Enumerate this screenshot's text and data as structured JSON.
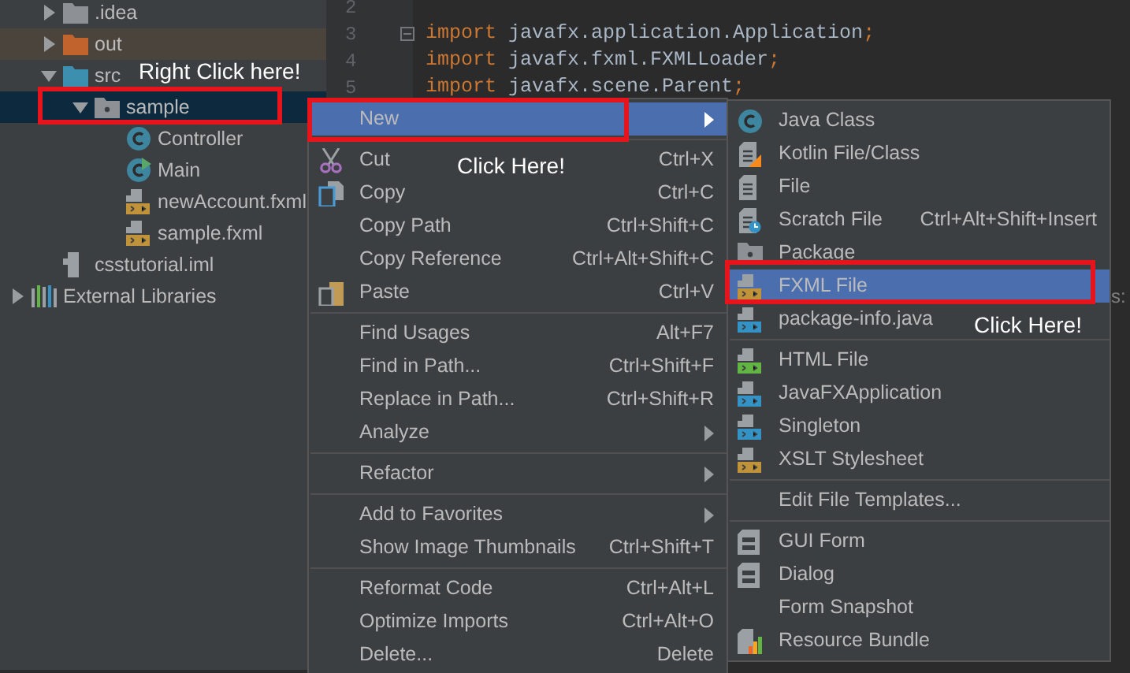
{
  "tree": [
    {
      "kind": "folder",
      "label": ".idea",
      "color": "#8d9195",
      "expanded": false,
      "selected": false
    },
    {
      "kind": "folder",
      "label": "out",
      "color": "#c0632c",
      "expanded": false,
      "selected": false,
      "excluded": true
    },
    {
      "kind": "folder",
      "label": "src",
      "color": "#3d8fb0",
      "expanded": true,
      "selected": false,
      "children": [
        {
          "kind": "package",
          "label": "sample",
          "expanded": true,
          "selected": true,
          "children": [
            {
              "kind": "class",
              "label": "Controller",
              "selected": false
            },
            {
              "kind": "main-class",
              "label": "Main",
              "selected": false
            },
            {
              "kind": "fxml",
              "label": "newAccount.fxml",
              "selected": false
            },
            {
              "kind": "fxml",
              "label": "sample.fxml",
              "selected": false
            }
          ]
        }
      ]
    },
    {
      "kind": "iml",
      "label": "csstutorial.iml",
      "selected": false
    },
    {
      "kind": "library",
      "label": "External Libraries",
      "expanded": false,
      "selected": false
    }
  ],
  "editor": {
    "lines": [
      {
        "number": "2"
      },
      {
        "number": "3",
        "fold": true,
        "tokens": [
          {
            "kind": "keyword",
            "text": "import"
          },
          {
            "kind": "plain",
            "text": " javafx.application.Application"
          },
          {
            "kind": "keyword",
            "text": ";"
          }
        ]
      },
      {
        "number": "4",
        "tokens": [
          {
            "kind": "keyword",
            "text": "import"
          },
          {
            "kind": "plain",
            "text": " javafx.fxml.FXMLLoader"
          },
          {
            "kind": "keyword",
            "text": ";"
          }
        ]
      },
      {
        "number": "5",
        "tokens": [
          {
            "kind": "keyword",
            "text": "import"
          },
          {
            "kind": "plain",
            "text": " javafx.scene.Parent"
          },
          {
            "kind": "keyword",
            "text": ";"
          }
        ]
      }
    ],
    "fragment": "s:"
  },
  "context_menu": {
    "items": [
      {
        "kind": "item",
        "label": "New",
        "submenu": true,
        "selected": true
      },
      {
        "kind": "separator"
      },
      {
        "kind": "item",
        "label": "Cut",
        "shortcut": "Ctrl+X",
        "selected": false
      },
      {
        "kind": "item",
        "label": "Copy",
        "shortcut": "Ctrl+C",
        "selected": false
      },
      {
        "kind": "item",
        "label": "Copy Path",
        "shortcut": "Ctrl+Shift+C",
        "selected": false
      },
      {
        "kind": "item",
        "label": "Copy Reference",
        "shortcut": "Ctrl+Alt+Shift+C",
        "selected": false
      },
      {
        "kind": "item",
        "label": "Paste",
        "shortcut": "Ctrl+V",
        "selected": false
      },
      {
        "kind": "separator"
      },
      {
        "kind": "item",
        "label": "Find Usages",
        "shortcut": "Alt+F7",
        "selected": false
      },
      {
        "kind": "item",
        "label": "Find in Path...",
        "shortcut": "Ctrl+Shift+F",
        "selected": false
      },
      {
        "kind": "item",
        "label": "Replace in Path...",
        "shortcut": "Ctrl+Shift+R",
        "selected": false
      },
      {
        "kind": "item",
        "label": "Analyze",
        "submenu": true,
        "selected": false
      },
      {
        "kind": "separator"
      },
      {
        "kind": "item",
        "label": "Refactor",
        "submenu": true,
        "selected": false
      },
      {
        "kind": "separator"
      },
      {
        "kind": "item",
        "label": "Add to Favorites",
        "submenu": true,
        "selected": false
      },
      {
        "kind": "item",
        "label": "Show Image Thumbnails",
        "shortcut": "Ctrl+Shift+T",
        "selected": false
      },
      {
        "kind": "separator"
      },
      {
        "kind": "item",
        "label": "Reformat Code",
        "shortcut": "Ctrl+Alt+L",
        "selected": false
      },
      {
        "kind": "item",
        "label": "Optimize Imports",
        "shortcut": "Ctrl+Alt+O",
        "selected": false
      },
      {
        "kind": "item",
        "label": "Delete...",
        "shortcut": "Delete",
        "selected": false
      }
    ]
  },
  "new_submenu": {
    "items": [
      {
        "kind": "item",
        "label": "Java Class",
        "selected": false
      },
      {
        "kind": "item",
        "label": "Kotlin File/Class",
        "selected": false
      },
      {
        "kind": "item",
        "label": "File",
        "selected": false
      },
      {
        "kind": "item",
        "label": "Scratch File",
        "shortcut": "Ctrl+Alt+Shift+Insert",
        "selected": false
      },
      {
        "kind": "item",
        "label": "Package",
        "selected": false
      },
      {
        "kind": "item",
        "label": "FXML File",
        "selected": true
      },
      {
        "kind": "item",
        "label": "package-info.java",
        "selected": false
      },
      {
        "kind": "separator"
      },
      {
        "kind": "item",
        "label": "HTML File",
        "selected": false
      },
      {
        "kind": "item",
        "label": "JavaFXApplication",
        "selected": false
      },
      {
        "kind": "item",
        "label": "Singleton",
        "selected": false
      },
      {
        "kind": "item",
        "label": "XSLT Stylesheet",
        "selected": false
      },
      {
        "kind": "separator"
      },
      {
        "kind": "item",
        "label": "Edit File Templates...",
        "selected": false
      },
      {
        "kind": "separator"
      },
      {
        "kind": "item",
        "label": "GUI Form",
        "selected": false
      },
      {
        "kind": "item",
        "label": "Dialog",
        "selected": false
      },
      {
        "kind": "item",
        "label": "Form Snapshot",
        "selected": false
      },
      {
        "kind": "item",
        "label": "Resource Bundle",
        "selected": false
      }
    ]
  },
  "annotations": [
    {
      "kind": "text",
      "text": "Right Click here!"
    },
    {
      "kind": "box"
    },
    {
      "kind": "box"
    },
    {
      "kind": "text",
      "text": "Click Here!"
    },
    {
      "kind": "box"
    },
    {
      "kind": "text",
      "text": "Click Here!"
    }
  ]
}
